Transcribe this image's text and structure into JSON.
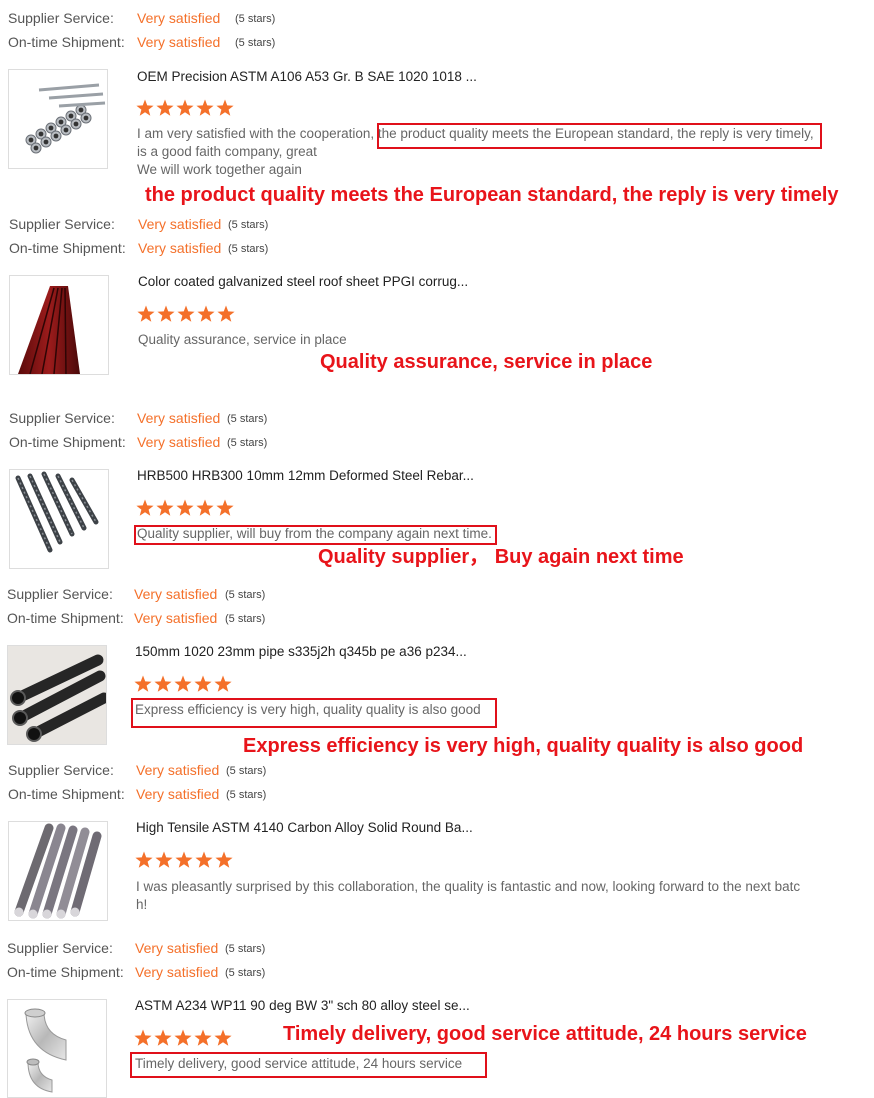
{
  "labels": {
    "supplier_service": "Supplier Service:",
    "on_time_shipment": "On-time Shipment:",
    "very_satisfied": "Very satisfied",
    "five_stars": "(5 stars)"
  },
  "colors": {
    "star": "#f4702a",
    "highlight_red": "#e8141a",
    "rating_text": "#f4702a"
  },
  "reviews": [
    {
      "title": "OEM Precision ASTM A106 A53 Gr. B SAE 1020 1018 ...",
      "thumbnail_icon": "steel-tubes-bundle-image",
      "stars": 5,
      "comment_lines": [
        "I am very satisfied with the cooperation, the product quality meets the European standard, the reply is very timely,",
        "is a good faith company, great",
        "We will work together again"
      ],
      "callout": "the product quality meets the European standard, the reply is very timely"
    },
    {
      "title": "Color coated galvanized steel roof sheet PPGI corrug...",
      "thumbnail_icon": "red-roof-sheet-image",
      "stars": 5,
      "comment_lines": [
        "Quality assurance, service in place"
      ],
      "callout": "Quality assurance, service in place"
    },
    {
      "title": "HRB500 HRB300 10mm 12mm Deformed Steel Rebar...",
      "thumbnail_icon": "steel-rebar-image",
      "stars": 5,
      "comment_lines": [
        "Quality supplier, will buy from the company again next time."
      ],
      "callout": "Quality supplier， Buy again next time"
    },
    {
      "title": "150mm 1020 23mm pipe s335j2h q345b pe a36 p234...",
      "thumbnail_icon": "black-pipes-image",
      "stars": 5,
      "comment_lines": [
        "Express efficiency is very high, quality quality is also good"
      ],
      "callout": "Express efficiency is very high, quality quality is also good"
    },
    {
      "title": "High Tensile ASTM 4140 Carbon Alloy Solid Round Ba...",
      "thumbnail_icon": "round-bars-image",
      "stars": 5,
      "comment_lines": [
        "I was pleasantly surprised by this collaboration, the quality is fantastic and now, looking forward to the next batc",
        "h!"
      ],
      "callout": ""
    },
    {
      "title": "ASTM A234 WP11 90 deg BW 3\" sch 80 alloy steel se...",
      "thumbnail_icon": "pipe-elbow-image",
      "stars": 5,
      "comment_lines": [
        "Timely delivery, good service attitude, 24 hours service"
      ],
      "callout": "Timely delivery, good service attitude, 24 hours service"
    }
  ]
}
